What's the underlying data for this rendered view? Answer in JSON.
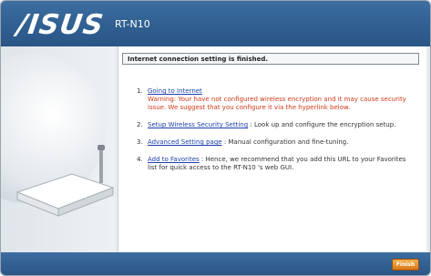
{
  "header": {
    "logo": "/ISUS",
    "model": "RT-N10"
  },
  "content": {
    "title": "Internet connection setting is finished.",
    "items": [
      {
        "num": "1.",
        "link": "Going to Internet",
        "warning": "Warning: Your have not configured wireless encryption and it may cause security issue. We suggest that you configure it via the hyperlink below.",
        "desc": ""
      },
      {
        "num": "2.",
        "link": "Setup Wireless Security Setting",
        "warning": "",
        "desc": ": Look up and configure the encryption setup."
      },
      {
        "num": "3.",
        "link": "Advanced Setting page",
        "warning": "",
        "desc": ": Manual configuration and fine-tuning."
      },
      {
        "num": "4.",
        "link": "Add to Favorites",
        "warning": "",
        "desc": ": Hence, we recommend that you add this URL to your Favorites list for quick access to the RT-N10 's web GUI."
      }
    ]
  },
  "footer": {
    "finish_label": "Finish"
  },
  "colors": {
    "header": "#2f5e90",
    "link": "#1b3fae",
    "warning": "#d13a1a",
    "button": "#e88a2a"
  }
}
